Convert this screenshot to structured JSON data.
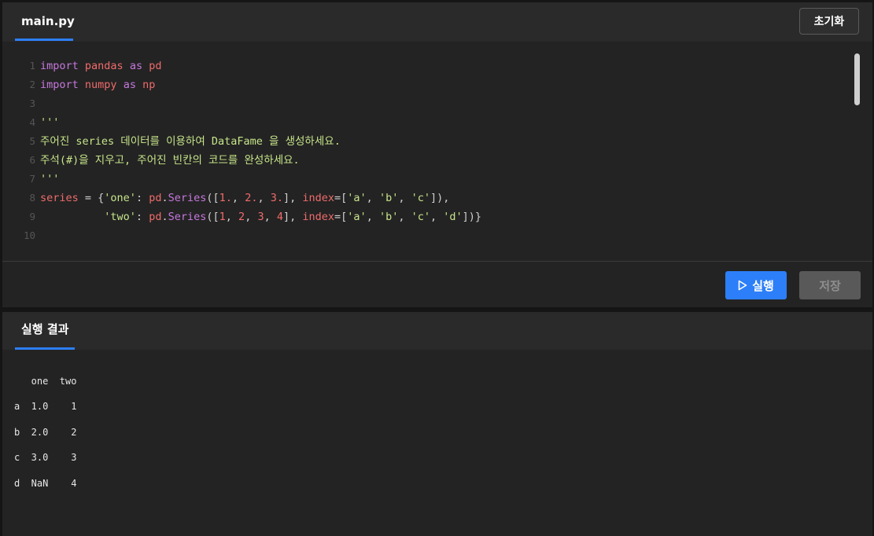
{
  "editor": {
    "tab_label": "main.py",
    "reset_label": "초기화",
    "lines": [
      {
        "n": "1",
        "tokens": [
          [
            "kw",
            "import"
          ],
          [
            "op",
            " "
          ],
          [
            "mod",
            "pandas"
          ],
          [
            "op",
            " "
          ],
          [
            "kw",
            "as"
          ],
          [
            "op",
            " "
          ],
          [
            "mod",
            "pd"
          ]
        ]
      },
      {
        "n": "2",
        "tokens": [
          [
            "kw",
            "import"
          ],
          [
            "op",
            " "
          ],
          [
            "mod",
            "numpy"
          ],
          [
            "op",
            " "
          ],
          [
            "kw",
            "as"
          ],
          [
            "op",
            " "
          ],
          [
            "mod",
            "np"
          ]
        ]
      },
      {
        "n": "3",
        "tokens": []
      },
      {
        "n": "4",
        "tokens": [
          [
            "doc",
            "'''"
          ]
        ]
      },
      {
        "n": "5",
        "tokens": [
          [
            "doc",
            "주어진 series 데이터를 이용하여 DataFame 을 생성하세요."
          ]
        ]
      },
      {
        "n": "6",
        "tokens": [
          [
            "doc",
            "주석(#)을 지우고, 주어진 빈칸의 코드를 완성하세요."
          ]
        ]
      },
      {
        "n": "7",
        "tokens": [
          [
            "doc",
            "'''"
          ]
        ]
      },
      {
        "n": "8",
        "tokens": [
          [
            "mod",
            "series"
          ],
          [
            "op",
            " = {"
          ],
          [
            "str",
            "'one'"
          ],
          [
            "op",
            ": "
          ],
          [
            "mod",
            "pd"
          ],
          [
            "op",
            "."
          ],
          [
            "fn",
            "Series"
          ],
          [
            "op",
            "(["
          ],
          [
            "num",
            "1."
          ],
          [
            "op",
            ", "
          ],
          [
            "num",
            "2."
          ],
          [
            "op",
            ", "
          ],
          [
            "num",
            "3."
          ],
          [
            "op",
            "], "
          ],
          [
            "param",
            "index"
          ],
          [
            "op",
            "=["
          ],
          [
            "str",
            "'a'"
          ],
          [
            "op",
            ", "
          ],
          [
            "str",
            "'b'"
          ],
          [
            "op",
            ", "
          ],
          [
            "str",
            "'c'"
          ],
          [
            "op",
            "]),"
          ]
        ]
      },
      {
        "n": "9",
        "tokens": [
          [
            "op",
            "          "
          ],
          [
            "str",
            "'two'"
          ],
          [
            "op",
            ": "
          ],
          [
            "mod",
            "pd"
          ],
          [
            "op",
            "."
          ],
          [
            "fn",
            "Series"
          ],
          [
            "op",
            "(["
          ],
          [
            "num",
            "1"
          ],
          [
            "op",
            ", "
          ],
          [
            "num",
            "2"
          ],
          [
            "op",
            ", "
          ],
          [
            "num",
            "3"
          ],
          [
            "op",
            ", "
          ],
          [
            "num",
            "4"
          ],
          [
            "op",
            "], "
          ],
          [
            "param",
            "index"
          ],
          [
            "op",
            "=["
          ],
          [
            "str",
            "'a'"
          ],
          [
            "op",
            ", "
          ],
          [
            "str",
            "'b'"
          ],
          [
            "op",
            ", "
          ],
          [
            "str",
            "'c'"
          ],
          [
            "op",
            ", "
          ],
          [
            "str",
            "'d'"
          ],
          [
            "op",
            "])}"
          ]
        ]
      },
      {
        "n": "10",
        "tokens": []
      }
    ],
    "run_label": "실행",
    "save_label": "저장"
  },
  "result": {
    "tab_label": "실행 결과",
    "output_header": "   one  two",
    "output_rows": [
      "a  1.0    1",
      "b  2.0    2",
      "c  3.0    3",
      "d  NaN    4"
    ]
  }
}
